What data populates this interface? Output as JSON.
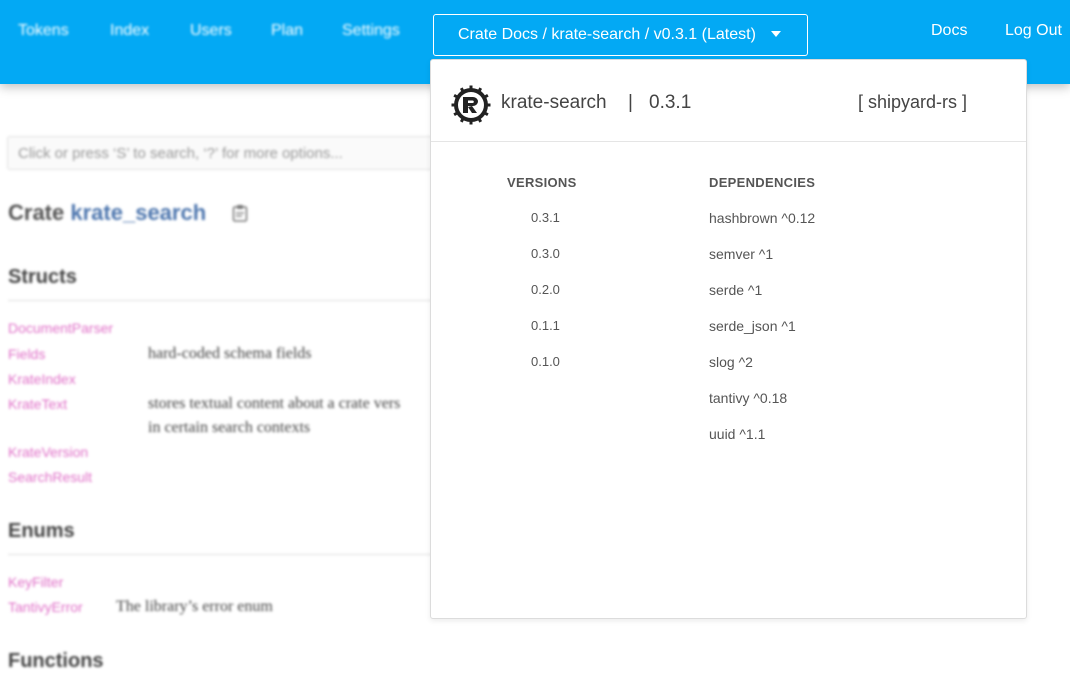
{
  "nav": {
    "items": [
      {
        "label": "Tokens"
      },
      {
        "label": "Index"
      },
      {
        "label": "Users"
      },
      {
        "label": "Plan"
      },
      {
        "label": "Settings"
      }
    ],
    "crate_select": "Crate Docs / krate-search / v0.3.1 (Latest)",
    "docs": "Docs",
    "logout": "Log Out"
  },
  "docs_page": {
    "search_placeholder": "Click or press ‘S’ to search, ‘?’ for more options...",
    "crate_prefix": "Crate",
    "crate_name": "krate_search",
    "structs_heading": "Structs",
    "structs": [
      {
        "name": "DocumentParser",
        "desc": ""
      },
      {
        "name": "Fields",
        "desc": "hard-coded schema fields"
      },
      {
        "name": "KrateIndex",
        "desc": ""
      },
      {
        "name": "KrateText",
        "desc": "stores textual content about a crate vers",
        "desc2": "in certain search contexts"
      },
      {
        "name": "KrateVersion",
        "desc": ""
      },
      {
        "name": "SearchResult",
        "desc": ""
      }
    ],
    "enums_heading": "Enums",
    "enums": [
      {
        "name": "KeyFilter",
        "desc": ""
      },
      {
        "name": "TantivyError",
        "desc": "The library’s error enum"
      }
    ],
    "functions_heading": "Functions"
  },
  "panel": {
    "crate_name": "krate-search",
    "separator": "|",
    "version": "0.3.1",
    "registry": "[ shipyard-rs ]",
    "versions_heading": "VERSIONS",
    "dependencies_heading": "DEPENDENCIES",
    "versions": [
      "0.3.1",
      "0.3.0",
      "0.2.0",
      "0.1.1",
      "0.1.0"
    ],
    "dependencies": [
      "hashbrown ^0.12",
      "semver ^1",
      "serde ^1",
      "serde_json ^1",
      "slog ^2",
      "tantivy ^0.18",
      "uuid ^1.1"
    ]
  },
  "colors": {
    "topbar": "#03a9f4",
    "link": "#e070c8",
    "crate_name": "#4d76ae"
  },
  "icons": {
    "logo": "rust-logo-icon",
    "caret": "chevron-down-icon",
    "clipboard": "clipboard-icon"
  }
}
